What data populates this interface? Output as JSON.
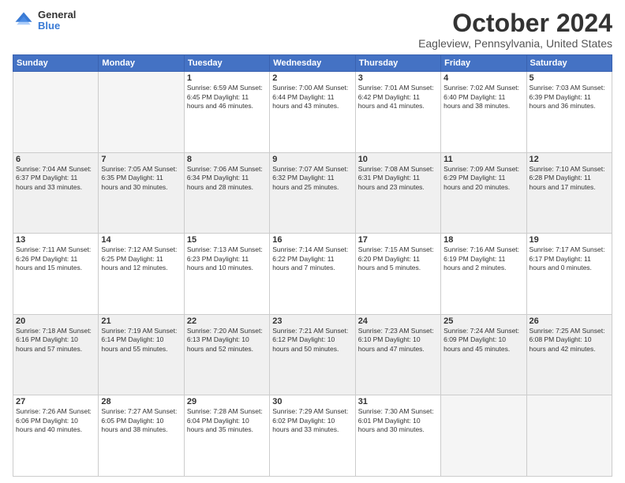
{
  "header": {
    "logo_general": "General",
    "logo_blue": "Blue",
    "title": "October 2024",
    "subtitle": "Eagleview, Pennsylvania, United States"
  },
  "weekdays": [
    "Sunday",
    "Monday",
    "Tuesday",
    "Wednesday",
    "Thursday",
    "Friday",
    "Saturday"
  ],
  "weeks": [
    [
      {
        "day": "",
        "info": ""
      },
      {
        "day": "",
        "info": ""
      },
      {
        "day": "1",
        "info": "Sunrise: 6:59 AM\nSunset: 6:45 PM\nDaylight: 11 hours and 46 minutes."
      },
      {
        "day": "2",
        "info": "Sunrise: 7:00 AM\nSunset: 6:44 PM\nDaylight: 11 hours and 43 minutes."
      },
      {
        "day": "3",
        "info": "Sunrise: 7:01 AM\nSunset: 6:42 PM\nDaylight: 11 hours and 41 minutes."
      },
      {
        "day": "4",
        "info": "Sunrise: 7:02 AM\nSunset: 6:40 PM\nDaylight: 11 hours and 38 minutes."
      },
      {
        "day": "5",
        "info": "Sunrise: 7:03 AM\nSunset: 6:39 PM\nDaylight: 11 hours and 36 minutes."
      }
    ],
    [
      {
        "day": "6",
        "info": "Sunrise: 7:04 AM\nSunset: 6:37 PM\nDaylight: 11 hours and 33 minutes."
      },
      {
        "day": "7",
        "info": "Sunrise: 7:05 AM\nSunset: 6:35 PM\nDaylight: 11 hours and 30 minutes."
      },
      {
        "day": "8",
        "info": "Sunrise: 7:06 AM\nSunset: 6:34 PM\nDaylight: 11 hours and 28 minutes."
      },
      {
        "day": "9",
        "info": "Sunrise: 7:07 AM\nSunset: 6:32 PM\nDaylight: 11 hours and 25 minutes."
      },
      {
        "day": "10",
        "info": "Sunrise: 7:08 AM\nSunset: 6:31 PM\nDaylight: 11 hours and 23 minutes."
      },
      {
        "day": "11",
        "info": "Sunrise: 7:09 AM\nSunset: 6:29 PM\nDaylight: 11 hours and 20 minutes."
      },
      {
        "day": "12",
        "info": "Sunrise: 7:10 AM\nSunset: 6:28 PM\nDaylight: 11 hours and 17 minutes."
      }
    ],
    [
      {
        "day": "13",
        "info": "Sunrise: 7:11 AM\nSunset: 6:26 PM\nDaylight: 11 hours and 15 minutes."
      },
      {
        "day": "14",
        "info": "Sunrise: 7:12 AM\nSunset: 6:25 PM\nDaylight: 11 hours and 12 minutes."
      },
      {
        "day": "15",
        "info": "Sunrise: 7:13 AM\nSunset: 6:23 PM\nDaylight: 11 hours and 10 minutes."
      },
      {
        "day": "16",
        "info": "Sunrise: 7:14 AM\nSunset: 6:22 PM\nDaylight: 11 hours and 7 minutes."
      },
      {
        "day": "17",
        "info": "Sunrise: 7:15 AM\nSunset: 6:20 PM\nDaylight: 11 hours and 5 minutes."
      },
      {
        "day": "18",
        "info": "Sunrise: 7:16 AM\nSunset: 6:19 PM\nDaylight: 11 hours and 2 minutes."
      },
      {
        "day": "19",
        "info": "Sunrise: 7:17 AM\nSunset: 6:17 PM\nDaylight: 11 hours and 0 minutes."
      }
    ],
    [
      {
        "day": "20",
        "info": "Sunrise: 7:18 AM\nSunset: 6:16 PM\nDaylight: 10 hours and 57 minutes."
      },
      {
        "day": "21",
        "info": "Sunrise: 7:19 AM\nSunset: 6:14 PM\nDaylight: 10 hours and 55 minutes."
      },
      {
        "day": "22",
        "info": "Sunrise: 7:20 AM\nSunset: 6:13 PM\nDaylight: 10 hours and 52 minutes."
      },
      {
        "day": "23",
        "info": "Sunrise: 7:21 AM\nSunset: 6:12 PM\nDaylight: 10 hours and 50 minutes."
      },
      {
        "day": "24",
        "info": "Sunrise: 7:23 AM\nSunset: 6:10 PM\nDaylight: 10 hours and 47 minutes."
      },
      {
        "day": "25",
        "info": "Sunrise: 7:24 AM\nSunset: 6:09 PM\nDaylight: 10 hours and 45 minutes."
      },
      {
        "day": "26",
        "info": "Sunrise: 7:25 AM\nSunset: 6:08 PM\nDaylight: 10 hours and 42 minutes."
      }
    ],
    [
      {
        "day": "27",
        "info": "Sunrise: 7:26 AM\nSunset: 6:06 PM\nDaylight: 10 hours and 40 minutes."
      },
      {
        "day": "28",
        "info": "Sunrise: 7:27 AM\nSunset: 6:05 PM\nDaylight: 10 hours and 38 minutes."
      },
      {
        "day": "29",
        "info": "Sunrise: 7:28 AM\nSunset: 6:04 PM\nDaylight: 10 hours and 35 minutes."
      },
      {
        "day": "30",
        "info": "Sunrise: 7:29 AM\nSunset: 6:02 PM\nDaylight: 10 hours and 33 minutes."
      },
      {
        "day": "31",
        "info": "Sunrise: 7:30 AM\nSunset: 6:01 PM\nDaylight: 10 hours and 30 minutes."
      },
      {
        "day": "",
        "info": ""
      },
      {
        "day": "",
        "info": ""
      }
    ]
  ]
}
